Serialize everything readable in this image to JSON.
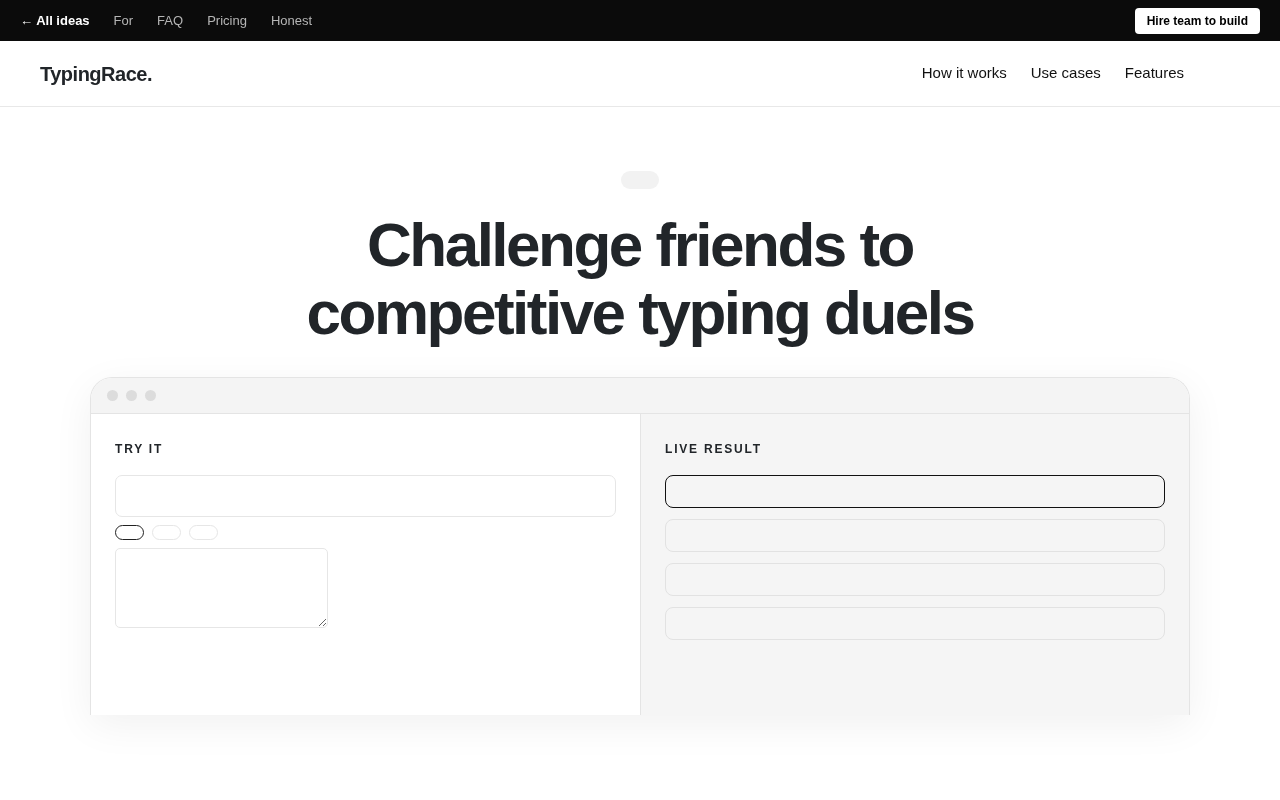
{
  "topbar": {
    "back_link": "← All ideas",
    "links": [
      "For",
      "FAQ",
      "Pricing",
      "Honest"
    ],
    "cta": "Hire team to build"
  },
  "header": {
    "logo": "TypingRace.",
    "nav": [
      "How it works",
      "Use cases",
      "Features"
    ]
  },
  "hero": {
    "headline": "Challenge friends to competitive typing duels"
  },
  "demo": {
    "left_title": "TRY IT",
    "chips": [
      {
        "selected": true
      },
      {
        "selected": false
      },
      {
        "selected": false
      }
    ],
    "right_title": "LIVE RESULT",
    "results": [
      {
        "selected": true
      },
      {
        "selected": false
      },
      {
        "selected": false
      },
      {
        "selected": false
      }
    ]
  }
}
